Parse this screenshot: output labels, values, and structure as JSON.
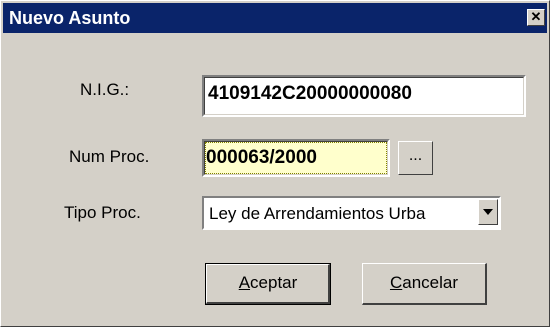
{
  "window": {
    "title": "Nuevo Asunto",
    "close_glyph": "✕"
  },
  "form": {
    "nig_label": "N.I.G.:",
    "nig_value": "4109142C20000000080",
    "num_proc_label": "Num Proc.",
    "num_proc_value": "000063/2000",
    "browse_label": "...",
    "tipo_proc_label": "Tipo Proc.",
    "tipo_proc_value": "Ley de Arrendamientos Urba"
  },
  "buttons": {
    "accept_first": "A",
    "accept_rest": "ceptar",
    "cancel_first": "C",
    "cancel_rest": "ancelar"
  },
  "colors": {
    "title_bg": "#0a246a",
    "dialog_bg": "#d4d0c8",
    "focused_field_bg": "#ffffcc"
  }
}
